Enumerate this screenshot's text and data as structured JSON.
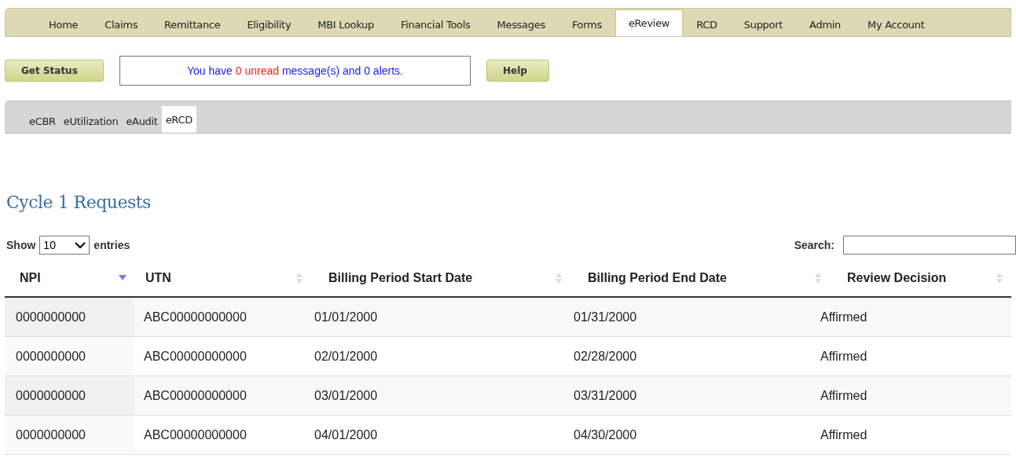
{
  "main_nav": [
    {
      "label": "Home",
      "selected": false
    },
    {
      "label": "Claims",
      "selected": false
    },
    {
      "label": "Remittance",
      "selected": false
    },
    {
      "label": "Eligibility",
      "selected": false
    },
    {
      "label": "MBI Lookup",
      "selected": false
    },
    {
      "label": "Financial Tools",
      "selected": false
    },
    {
      "label": "Messages",
      "selected": false
    },
    {
      "label": "Forms",
      "selected": false
    },
    {
      "label": "eReview",
      "selected": true
    },
    {
      "label": "RCD",
      "selected": false
    },
    {
      "label": "Support",
      "selected": false
    },
    {
      "label": "Admin",
      "selected": false
    },
    {
      "label": "My Account",
      "selected": false
    }
  ],
  "status_button": "Get Status",
  "message": [
    {
      "text": "You have ",
      "alert": false
    },
    {
      "text": "0 unread",
      "alert": true
    },
    {
      "text": " message(s) and 0 alerts.",
      "alert": false
    }
  ],
  "help_button": "Help",
  "sub_nav": [
    {
      "label": "eCBR",
      "selected": false
    },
    {
      "label": "eUtilization",
      "selected": false
    },
    {
      "label": "eAudit",
      "selected": false
    },
    {
      "label": "eRCD",
      "selected": true
    }
  ],
  "heading": "Cycle 1 Requests",
  "length": {
    "before": "Show",
    "value": "10",
    "after": "entries"
  },
  "search": {
    "label": "Search:"
  },
  "table": {
    "columns": [
      {
        "label": "NPI",
        "sorted": true
      },
      {
        "label": "UTN",
        "sorted": false
      },
      {
        "label": "Billing Period Start Date",
        "sorted": false
      },
      {
        "label": "Billing Period End Date",
        "sorted": false
      },
      {
        "label": "Review Decision",
        "sorted": false
      }
    ],
    "rows": [
      [
        "0000000000",
        "ABC00000000000",
        "01/01/2000",
        "01/31/2000",
        "Affirmed"
      ],
      [
        "0000000000",
        "ABC00000000000",
        "02/01/2000",
        "02/28/2000",
        "Affirmed"
      ],
      [
        "0000000000",
        "ABC00000000000",
        "03/01/2000",
        "03/31/2000",
        "Affirmed"
      ],
      [
        "0000000000",
        "ABC00000000000",
        "04/01/2000",
        "04/30/2000",
        "Affirmed"
      ]
    ]
  }
}
